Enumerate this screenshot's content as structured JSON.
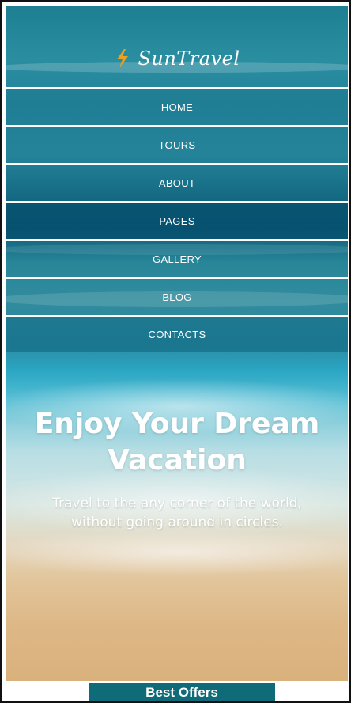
{
  "brand": {
    "name": "SunTravel",
    "icon": "lightning-bolt-icon",
    "icon_color": "#f0a020"
  },
  "nav": {
    "items": [
      {
        "label": "HOME"
      },
      {
        "label": "TOURS"
      },
      {
        "label": "ABOUT"
      },
      {
        "label": "PAGES",
        "active": true
      },
      {
        "label": "GALLERY"
      },
      {
        "label": "BLOG"
      },
      {
        "label": "CONTACTS"
      }
    ]
  },
  "hero": {
    "title_line1": "Enjoy Your Dream",
    "title_line2": "Vacation",
    "subtitle_line1": "Travel to the any corner of the world,",
    "subtitle_line2": "without going around in circles."
  },
  "offers": {
    "label": "Best Offers",
    "color": "#0f6b78"
  }
}
